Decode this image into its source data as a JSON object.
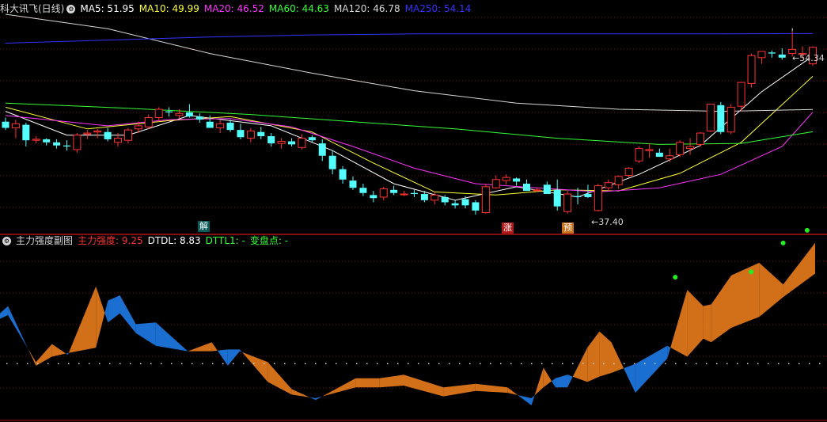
{
  "header": {
    "stock_name": "科大讯飞(日线)",
    "ma": [
      {
        "label": "MA5: 51.95",
        "color": "#ffffff"
      },
      {
        "label": "MA10: 49.99",
        "color": "#ffff33"
      },
      {
        "label": "MA20: 46.52",
        "color": "#ff33ff"
      },
      {
        "label": "MA60: 44.63",
        "color": "#33ff33"
      },
      {
        "label": "MA120: 46.78",
        "color": "#d8d8d8"
      },
      {
        "label": "MA250: 54.14",
        "color": "#3333ff"
      }
    ]
  },
  "sub_header": {
    "name": "主力强度副图",
    "items": [
      {
        "label": "主力强度: 9.25",
        "color": "#ff3333"
      },
      {
        "label": "DTDL: 8.83",
        "color": "#ffffff"
      },
      {
        "label": "DTTL1: -",
        "color": "#33ff33"
      },
      {
        "label": "变盘点: -",
        "color": "#33ff33"
      }
    ]
  },
  "annotations": {
    "high_label": "54.34",
    "low_label": "37.40",
    "signal_jie": "解",
    "signal_zhang": "涨",
    "signal_yu": "预"
  },
  "chart_data": [
    {
      "type": "candlestick",
      "title": "科大讯飞(日线)",
      "ylim": [
        35,
        56
      ],
      "candles": [
        [
          45.6,
          46.0,
          44.8,
          45.0
        ],
        [
          45.0,
          45.8,
          44.0,
          45.4
        ],
        [
          45.3,
          45.5,
          43.2,
          43.8
        ],
        [
          43.8,
          44.2,
          43.5,
          43.9
        ],
        [
          43.9,
          44.0,
          43.3,
          43.6
        ],
        [
          43.6,
          43.9,
          43.0,
          43.3
        ],
        [
          43.3,
          43.8,
          42.8,
          43.2
        ],
        [
          42.9,
          44.5,
          42.6,
          44.3
        ],
        [
          44.4,
          44.8,
          43.9,
          44.5
        ],
        [
          44.6,
          44.9,
          44.0,
          44.7
        ],
        [
          44.6,
          45.0,
          43.7,
          43.9
        ],
        [
          43.6,
          44.5,
          43.2,
          44.0
        ],
        [
          43.8,
          45.0,
          43.5,
          44.8
        ],
        [
          44.9,
          45.6,
          44.5,
          45.2
        ],
        [
          45.1,
          46.3,
          44.9,
          46.0
        ],
        [
          46.0,
          47.0,
          45.6,
          46.8
        ],
        [
          46.6,
          47.0,
          46.1,
          46.5
        ],
        [
          46.2,
          46.8,
          45.9,
          46.4
        ],
        [
          46.5,
          47.3,
          46.0,
          46.1
        ],
        [
          46.1,
          46.4,
          45.5,
          45.8
        ],
        [
          45.6,
          46.2,
          45.2,
          45.0
        ],
        [
          45.0,
          45.8,
          44.5,
          45.4
        ],
        [
          45.5,
          45.8,
          44.6,
          44.8
        ],
        [
          44.8,
          45.4,
          43.9,
          44.1
        ],
        [
          44.0,
          45.0,
          43.6,
          44.7
        ],
        [
          44.6,
          45.1,
          43.9,
          44.2
        ],
        [
          44.2,
          44.5,
          43.2,
          43.5
        ],
        [
          43.5,
          44.0,
          43.0,
          43.7
        ],
        [
          43.7,
          44.0,
          43.2,
          43.4
        ],
        [
          43.1,
          44.4,
          42.9,
          44.0
        ],
        [
          44.1,
          44.3,
          43.6,
          43.8
        ],
        [
          43.5,
          43.9,
          41.8,
          42.3
        ],
        [
          42.3,
          42.8,
          40.5,
          41.0
        ],
        [
          41.0,
          41.3,
          39.6,
          40.0
        ],
        [
          39.9,
          40.3,
          39.0,
          39.2
        ],
        [
          39.2,
          39.6,
          38.4,
          38.7
        ],
        [
          38.5,
          38.9,
          37.8,
          38.2
        ],
        [
          38.3,
          39.3,
          38.0,
          39.1
        ],
        [
          39.0,
          39.4,
          38.5,
          38.7
        ],
        [
          38.6,
          38.9,
          38.4,
          38.6
        ],
        [
          38.7,
          39.0,
          38.3,
          38.6
        ],
        [
          38.6,
          38.9,
          37.8,
          38.0
        ],
        [
          38.0,
          38.8,
          37.6,
          38.5
        ],
        [
          38.3,
          38.5,
          37.5,
          37.8
        ],
        [
          37.7,
          38.0,
          37.2,
          37.5
        ],
        [
          38.1,
          38.4,
          37.2,
          37.5
        ],
        [
          37.8,
          38.0,
          36.6,
          37.0
        ],
        [
          36.8,
          39.6,
          36.7,
          39.3
        ],
        [
          39.2,
          40.4,
          39.1,
          40.0
        ],
        [
          39.9,
          40.5,
          39.5,
          40.2
        ],
        [
          40.1,
          40.2,
          39.4,
          39.8
        ],
        [
          39.6,
          40.0,
          38.9,
          38.9
        ],
        [
          39.0,
          39.2,
          38.8,
          39.0
        ],
        [
          39.5,
          39.8,
          38.7,
          38.6
        ],
        [
          39.0,
          40.0,
          37.0,
          37.4
        ],
        [
          36.9,
          38.9,
          36.7,
          38.6
        ],
        [
          38.4,
          39.2,
          37.6,
          38.3
        ],
        [
          38.6,
          39.5,
          38.2,
          38.3
        ],
        [
          37.0,
          39.6,
          36.9,
          39.4
        ],
        [
          39.2,
          40.0,
          38.9,
          39.7
        ],
        [
          39.5,
          40.4,
          39.1,
          40.3
        ],
        [
          40.4,
          41.2,
          40.2,
          41.1
        ],
        [
          41.8,
          43.2,
          41.6,
          43.0
        ],
        [
          42.8,
          43.5,
          42.1,
          42.9
        ],
        [
          42.6,
          43.0,
          42.2,
          42.2
        ],
        [
          42.0,
          43.0,
          41.7,
          42.3
        ],
        [
          42.4,
          43.8,
          42.2,
          43.6
        ],
        [
          43.0,
          44.0,
          42.4,
          43.2
        ],
        [
          43.4,
          44.6,
          43.2,
          44.5
        ],
        [
          44.7,
          47.3,
          44.6,
          47.3
        ],
        [
          47.2,
          47.5,
          44.4,
          44.6
        ],
        [
          44.6,
          47.3,
          44.4,
          47.0
        ],
        [
          47.1,
          49.4,
          46.6,
          49.4
        ],
        [
          49.3,
          52.2,
          48.9,
          52.0
        ],
        [
          51.8,
          52.4,
          51.2,
          52.4
        ],
        [
          52.3,
          52.5,
          51.8,
          52.2
        ],
        [
          52.1,
          52.7,
          51.6,
          51.8
        ],
        [
          52.2,
          54.3,
          51.9,
          52.6
        ],
        [
          52.1,
          52.9,
          51.7,
          52.2
        ],
        [
          51.2,
          52.9,
          51.0,
          52.8
        ]
      ],
      "ma_series": [
        {
          "name": "MA5",
          "color": "#ffffff",
          "values": [
            [
              0,
              46.6
            ],
            [
              6,
              44.3
            ],
            [
              12,
              44.3
            ],
            [
              18,
              46.2
            ],
            [
              26,
              45.2
            ],
            [
              32,
              42.8
            ],
            [
              38,
              39.6
            ],
            [
              44,
              38.0
            ],
            [
              50,
              39.3
            ],
            [
              56,
              38.3
            ],
            [
              62,
              40.5
            ],
            [
              68,
              43.3
            ],
            [
              74,
              48.5
            ],
            [
              79,
              51.95
            ]
          ]
        },
        {
          "name": "MA10",
          "color": "#ffff33",
          "values": [
            [
              0,
              47.0
            ],
            [
              8,
              44.9
            ],
            [
              16,
              45.7
            ],
            [
              22,
              46.1
            ],
            [
              30,
              44.6
            ],
            [
              36,
              41.6
            ],
            [
              42,
              38.8
            ],
            [
              48,
              38.5
            ],
            [
              54,
              39.0
            ],
            [
              60,
              38.9
            ],
            [
              66,
              40.6
            ],
            [
              72,
              43.6
            ],
            [
              79,
              49.99
            ]
          ]
        },
        {
          "name": "MA20",
          "color": "#ff33ff",
          "values": [
            [
              0,
              46.2
            ],
            [
              10,
              45.2
            ],
            [
              16,
              45.8
            ],
            [
              22,
              45.9
            ],
            [
              28,
              45.1
            ],
            [
              34,
              43.2
            ],
            [
              40,
              41.1
            ],
            [
              46,
              39.6
            ],
            [
              52,
              39.2
            ],
            [
              58,
              38.8
            ],
            [
              64,
              39.2
            ],
            [
              70,
              40.5
            ],
            [
              76,
              43.2
            ],
            [
              79,
              46.52
            ]
          ]
        },
        {
          "name": "MA60",
          "color": "#33ff33",
          "values": [
            [
              0,
              47.4
            ],
            [
              12,
              46.9
            ],
            [
              24,
              46.3
            ],
            [
              34,
              45.6
            ],
            [
              44,
              44.9
            ],
            [
              54,
              44.0
            ],
            [
              64,
              43.4
            ],
            [
              72,
              43.5
            ],
            [
              79,
              44.63
            ]
          ]
        },
        {
          "name": "MA120",
          "color": "#d8d8d8",
          "values": [
            [
              0,
              56.0
            ],
            [
              10,
              54.6
            ],
            [
              20,
              52.2
            ],
            [
              30,
              50.3
            ],
            [
              40,
              48.6
            ],
            [
              50,
              47.4
            ],
            [
              60,
              46.8
            ],
            [
              70,
              46.6
            ],
            [
              79,
              46.78
            ]
          ]
        },
        {
          "name": "MA250",
          "color": "#3333ff",
          "values": [
            [
              0,
              53.2
            ],
            [
              10,
              53.5
            ],
            [
              20,
              53.8
            ],
            [
              30,
              54.0
            ],
            [
              40,
              54.1
            ],
            [
              50,
              54.1
            ],
            [
              60,
              54.1
            ],
            [
              70,
              54.1
            ],
            [
              79,
              54.14
            ]
          ]
        }
      ],
      "high": {
        "index": 77,
        "value": 54.34
      },
      "low": {
        "index": 54,
        "value": 37.4
      }
    },
    {
      "type": "area",
      "title": "主力强度副图",
      "ylim": [
        0,
        100
      ],
      "series": [
        {
          "name": "主力强度",
          "values": [
            [
              0,
              55
            ],
            [
              2,
              57
            ],
            [
              9,
              31
            ],
            [
              13,
              41
            ],
            [
              17,
              35
            ],
            [
              24,
              73
            ],
            [
              27,
              53
            ],
            [
              30,
              58
            ],
            [
              34,
              47
            ],
            [
              39,
              40
            ],
            [
              47,
              37
            ],
            [
              53,
              42
            ],
            [
              57,
              29
            ],
            [
              60,
              37
            ],
            [
              67,
              31
            ],
            [
              73,
              16
            ],
            [
              79,
              10
            ],
            [
              89,
              22
            ],
            [
              95,
              22
            ],
            [
              101,
              24
            ],
            [
              111,
              17
            ],
            [
              119,
              19
            ],
            [
              127,
              17
            ],
            [
              133,
              7
            ],
            [
              136,
              28
            ],
            [
              139,
              17
            ],
            [
              142,
              17
            ],
            [
              147,
              39
            ],
            [
              150,
              48
            ],
            [
              153,
              42
            ],
            [
              159,
              14
            ],
            [
              167,
              33
            ],
            [
              172,
              71
            ],
            [
              176,
              62
            ],
            [
              178,
              63
            ],
            [
              183,
              79
            ],
            [
              190,
              86
            ],
            [
              196,
              74
            ],
            [
              204,
              97
            ]
          ]
        },
        {
          "name": "DTDL",
          "values": [
            [
              0,
              58
            ],
            [
              2,
              62
            ],
            [
              9,
              29
            ],
            [
              13,
              34
            ],
            [
              17,
              36
            ],
            [
              24,
              39
            ],
            [
              27,
              65
            ],
            [
              30,
              68
            ],
            [
              34,
              52
            ],
            [
              39,
              53
            ],
            [
              47,
              37
            ],
            [
              53,
              37
            ],
            [
              57,
              38
            ],
            [
              60,
              38
            ],
            [
              67,
              20
            ],
            [
              73,
              13
            ],
            [
              79,
              11
            ],
            [
              89,
              17
            ],
            [
              95,
              17
            ],
            [
              101,
              18
            ],
            [
              111,
              12
            ],
            [
              119,
              15
            ],
            [
              127,
              14
            ],
            [
              133,
              11
            ],
            [
              136,
              17
            ],
            [
              139,
              22
            ],
            [
              142,
              24
            ],
            [
              147,
              20
            ],
            [
              150,
              23
            ],
            [
              153,
              25
            ],
            [
              159,
              30
            ],
            [
              167,
              40
            ],
            [
              172,
              34
            ],
            [
              176,
              44
            ],
            [
              178,
              42
            ],
            [
              183,
              50
            ],
            [
              190,
              56
            ],
            [
              196,
              67
            ],
            [
              204,
              80
            ]
          ]
        }
      ],
      "dots": [
        [
          169,
          78
        ],
        [
          188,
          81
        ],
        [
          196,
          97
        ],
        [
          202,
          104
        ]
      ],
      "flat_line": 30
    }
  ]
}
